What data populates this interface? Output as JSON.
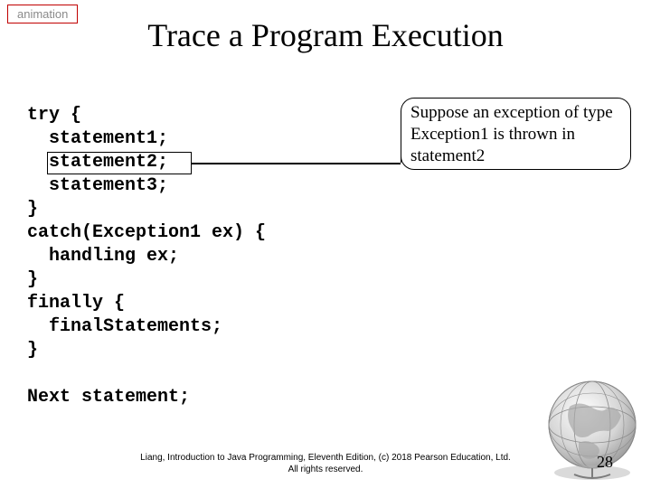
{
  "tag": "animation",
  "title": "Trace a Program Execution",
  "code": {
    "l1": "try {",
    "l2": "  statement1;",
    "l3": "  statement2;",
    "l4": "  statement3;",
    "l5": "}",
    "l6": "catch(Exception1 ex) {",
    "l7": "  handling ex;",
    "l8": "}",
    "l9": "finally {",
    "l10": "  finalStatements;",
    "l11": "}",
    "l12": "",
    "l13": "Next statement;"
  },
  "callout": "Suppose an exception of type Exception1 is thrown in statement2",
  "footer_line1": "Liang, Introduction to Java Programming, Eleventh Edition, (c) 2018 Pearson Education, Ltd.",
  "footer_line2": "All rights reserved.",
  "pagenum": "28"
}
